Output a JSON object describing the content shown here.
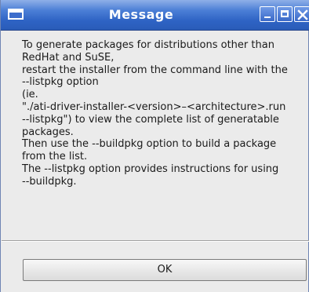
{
  "window": {
    "title": "Message"
  },
  "titlebar": {
    "accent_color": "#2e63c4",
    "icons": [
      "window-menu-icon",
      "minimize-icon",
      "maximize-icon",
      "close-icon"
    ]
  },
  "message": {
    "lines": [
      "To generate packages for distributions other than",
      "RedHat and SuSE,",
      "restart the installer from the command line with the",
      "--listpkg option",
      "(ie.",
      "\"./ati-driver-installer-<version>–<architecture>.run",
      "--listpkg\") to view the complete list of generatable",
      "packages.",
      "Then use the --buildpkg option to build a package",
      "from the list.",
      "The --listpkg option provides instructions for using",
      "--buildpkg."
    ]
  },
  "buttons": {
    "ok_label": "OK"
  }
}
